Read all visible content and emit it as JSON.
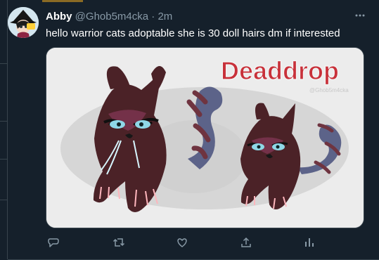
{
  "tweet": {
    "display_name": "Abby",
    "handle": "@Ghob5m4cka",
    "separator": "·",
    "time": "2m",
    "text": "hello warrior cats adoptable she is 30 doll hairs dm if interested"
  },
  "media": {
    "title_text": "Deaddrop",
    "signature_text": "@Ghob5m4cka",
    "icon": "cat-illustration"
  },
  "icons": {
    "avatar": "avatar-icon",
    "more": "more-icon",
    "reply": "reply-icon",
    "retweet": "retweet-icon",
    "like": "like-icon",
    "share": "share-icon",
    "analytics": "analytics-icon"
  },
  "colors": {
    "background": "#15202b",
    "text": "#ffffff",
    "muted_text": "#8899a6",
    "border": "#38444d",
    "title": "#c8313a"
  }
}
